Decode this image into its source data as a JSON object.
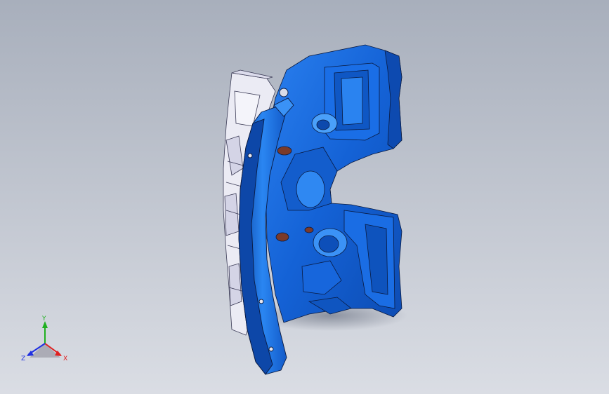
{
  "viewport": {
    "background_top": "#a9b0bd",
    "background_bottom": "#d9dde4",
    "model_color": "#1565d8",
    "model_highlight": "#4fa3ff",
    "model_shadow": "#0b3f99",
    "hidden_part_color": "#e8e8f2",
    "edge_color": "#0a1a40",
    "shadow_color": "#7d8494"
  },
  "triad": {
    "x_label": "X",
    "y_label": "Y",
    "z_label": "Z",
    "x_color": "#e02020",
    "y_color": "#20b020",
    "z_color": "#2030e0"
  }
}
